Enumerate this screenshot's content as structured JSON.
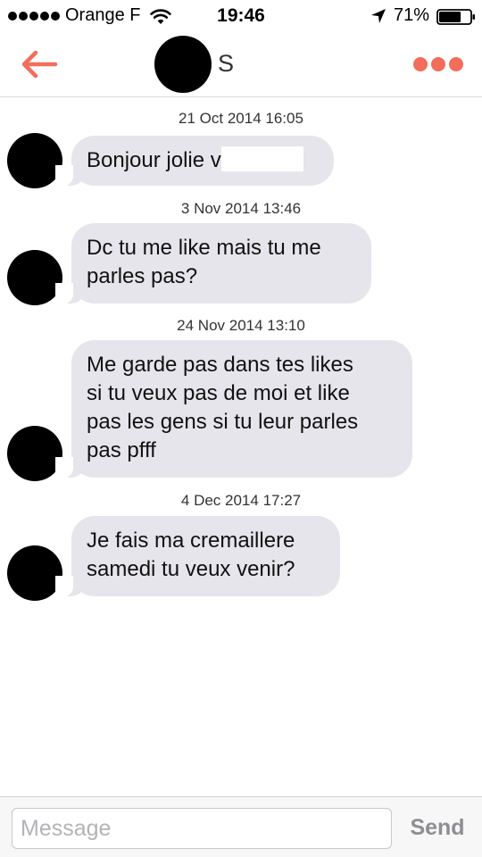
{
  "status_bar": {
    "carrier": "Orange F",
    "time": "19:46",
    "battery_percent": "71%",
    "battery_level": 0.71,
    "signal_bars": 5,
    "icons": [
      "wifi-icon",
      "location-arrow-icon",
      "battery-icon"
    ]
  },
  "nav": {
    "contact_name": "S",
    "back_icon": "arrow-left-icon",
    "more_icon": "ellipsis-icon",
    "accent_color": "#f26d5b"
  },
  "conversation": [
    {
      "timestamp": "21 Oct 2014 16:05",
      "text": "Bonjour jolie v",
      "redacted_tail": true
    },
    {
      "timestamp": "3 Nov 2014 13:46",
      "text": "Dc tu me like mais tu me\nparles pas?"
    },
    {
      "timestamp": "24 Nov 2014 13:10",
      "text": "Me garde pas dans tes likes\nsi tu veux pas de moi et like\npas les gens si tu leur parles\npas pfff"
    },
    {
      "timestamp": "4 Dec 2014 17:27",
      "text": "Je fais ma cremaillere\nsamedi tu veux venir?"
    }
  ],
  "composer": {
    "placeholder": "Message",
    "value": "",
    "send_label": "Send"
  },
  "colors": {
    "bubble": "#e6e5eb",
    "send_disabled": "#8e8e93"
  }
}
